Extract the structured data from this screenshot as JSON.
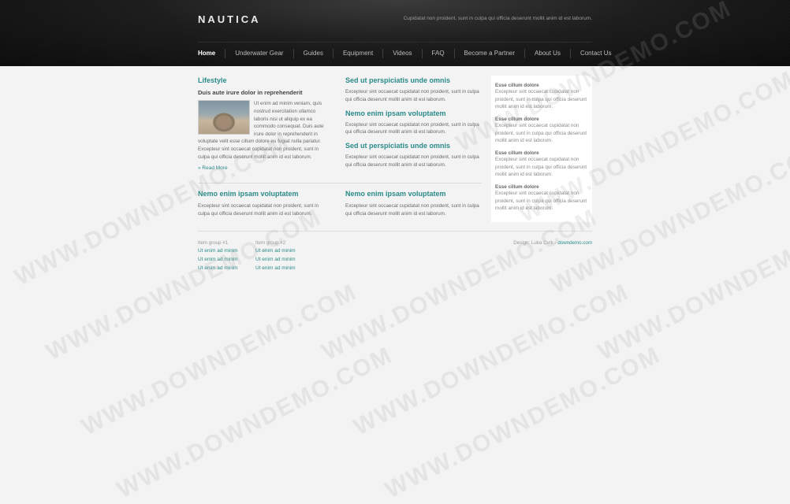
{
  "site": {
    "logo": "NAUTICA",
    "tagline": "Cupidatat non proident, sunt in culpa qui officia deserunt mollit anim id est laborum."
  },
  "nav": [
    {
      "label": "Home",
      "active": true
    },
    {
      "label": "Underwater Gear"
    },
    {
      "label": "Guides"
    },
    {
      "label": "Equipment"
    },
    {
      "label": "Videos"
    },
    {
      "label": "FAQ"
    },
    {
      "label": "Become a Partner"
    },
    {
      "label": "About Us"
    },
    {
      "label": "Contact Us"
    }
  ],
  "lifestyle": {
    "title": "Lifestyle",
    "subhead": "Duis aute irure dolor in reprehenderit",
    "wrap_text": "Ut enim ad minim veniam, quis nostrud exercitation ullamco laboris nisi ut aliquip ex ea commodo consequat. Duis aute irure dolor in reprehenderit in",
    "full_text": "voluptate velit esse cillum dolore eu fugiat nulla pariatur. Excepteur sint occaecat cupidatat non proident, sunt in culpa qui officia deserunt mollit anim id est laborum.",
    "read_more": "» Read More"
  },
  "middle": [
    {
      "title": "Sed ut perspiciatis unde omnis",
      "text": "Excepteur sint occaecat cupidatat non proident, sunt in culpa qui officia deserunt mollit anim id est laborum."
    },
    {
      "title": "Nemo enim ipsam voluptatem",
      "text": "Excepteur sint occaecat cupidatat non proident, sunt in culpa qui officia deserunt mollit anim id est laborum."
    },
    {
      "title": "Sed ut perspiciatis unde omnis",
      "text": "Excepteur sint occaecat cupidatat non proident, sunt in culpa qui officia deserunt mollit anim id est laborum."
    }
  ],
  "bottom": [
    {
      "title": "Nemo enim ipsam voluptatem",
      "text": "Excepteur sint occaecat cupidatat non proident, sunt in culpa qui officia deserunt mollit anim id est laborum."
    },
    {
      "title": "Nemo enim ipsam voluptatem",
      "text": "Excepteur sint occaecat cupidatat non proident, sunt in culpa qui officia deserunt mollit anim id est laborum."
    }
  ],
  "sidebar": [
    {
      "title": "Esse cillum dolore",
      "text": "Excepteur sint occaecat cupidatat non proident, sunt in culpa qui officia deserunt mollit anim id est laborum."
    },
    {
      "title": "Esse cillum dolore",
      "text": "Excepteur sint occaecat cupidatat non proident, sunt in culpa qui officia deserunt mollit anim id est laborum."
    },
    {
      "title": "Esse cillum dolore",
      "text": "Excepteur sint occaecat cupidatat non proident, sunt in culpa qui officia deserunt mollit anim id est laborum."
    },
    {
      "title": "Esse cillum dolore",
      "text": "Excepteur sint occaecat cupidatat non proident, sunt in culpa qui officia deserunt mollit anim id est laborum."
    }
  ],
  "footer": {
    "groups": [
      {
        "label": "Item group #1",
        "links": [
          "Ut enim ad minim",
          "Ut enim ad minim",
          "Ut enim ad minim"
        ]
      },
      {
        "label": "Item group #2",
        "links": [
          "Ut enim ad minim",
          "Ut enim ad minim",
          "Ut enim ad minim"
        ]
      }
    ],
    "credit_prefix": "Design: Luka Cvrk -",
    "credit_link": "downdemo.com"
  },
  "watermark": "WWW.DOWNDEMO.COM",
  "colors": {
    "accent": "#2b8a8a",
    "header_bg": "#111111",
    "page_bg": "#f3f3f3"
  }
}
